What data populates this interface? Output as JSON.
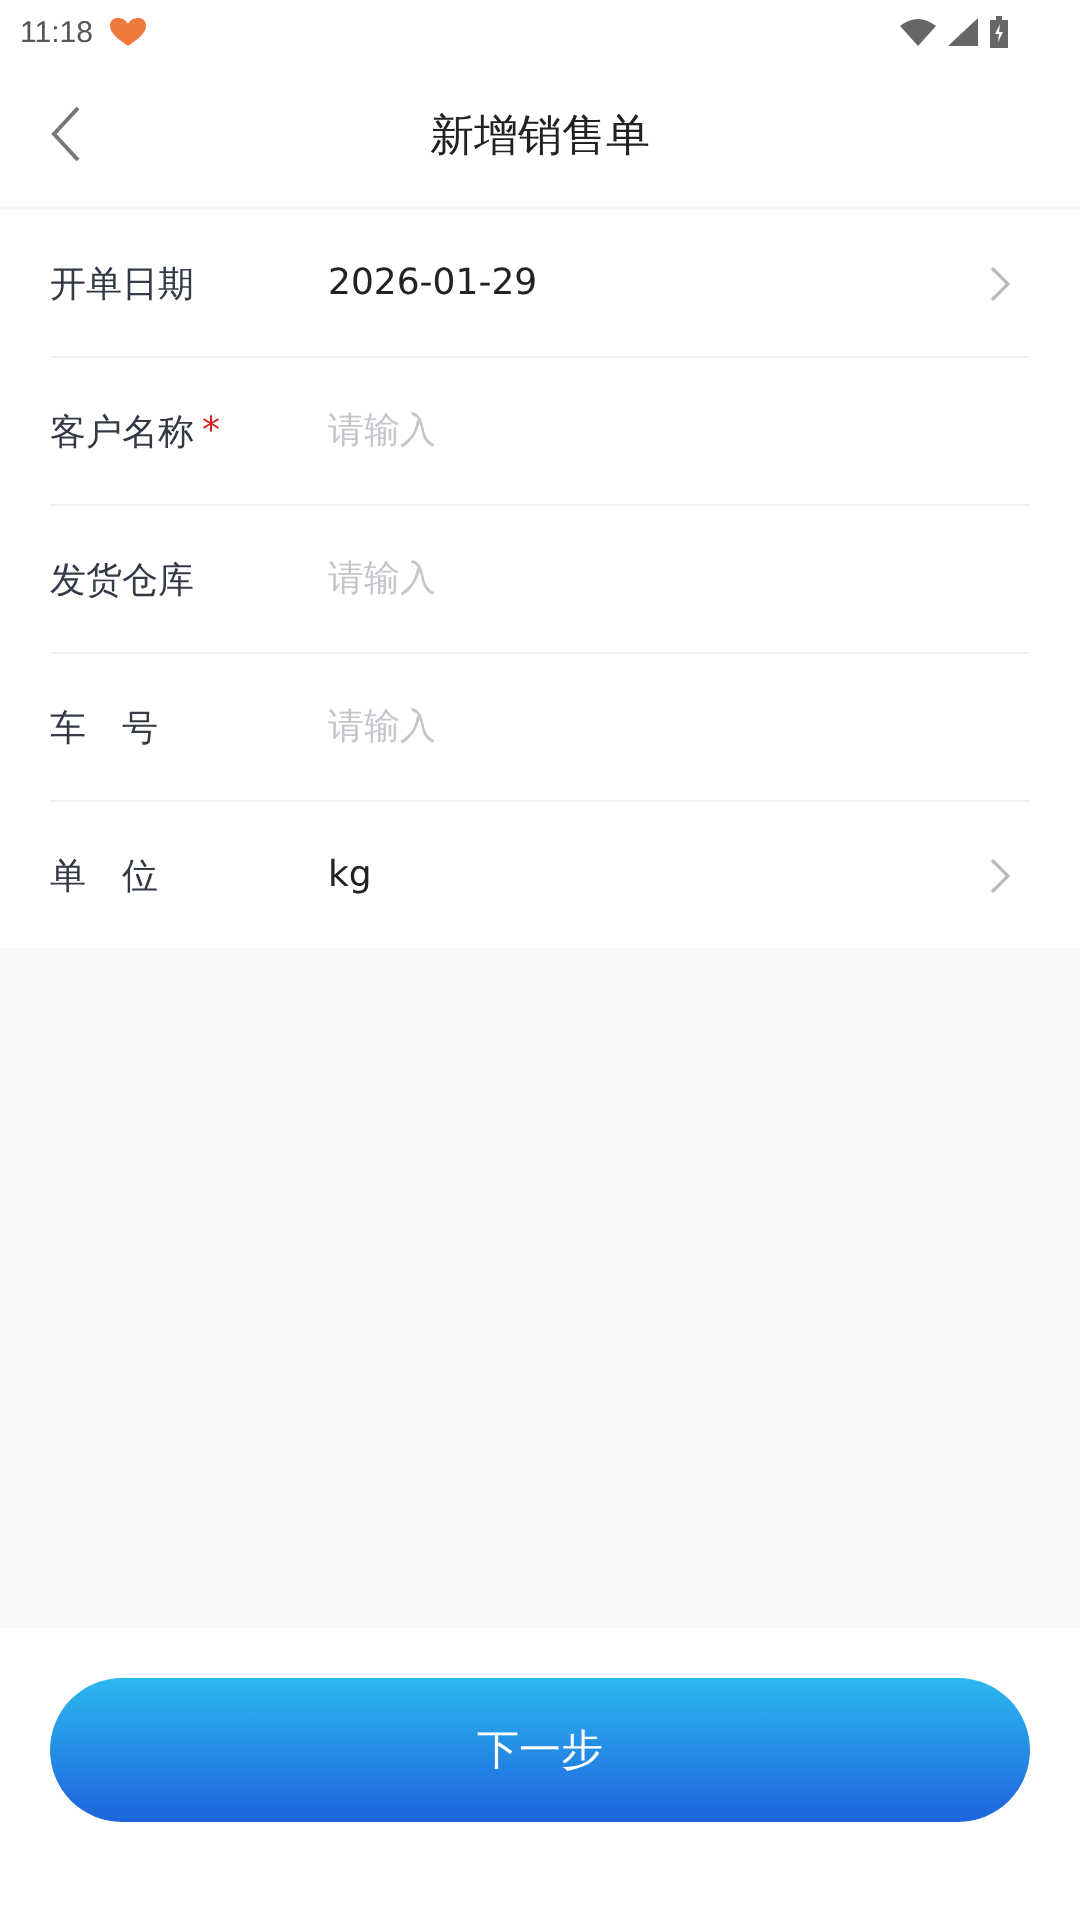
{
  "status_bar": {
    "time": "11:18"
  },
  "header": {
    "title": "新增销售单"
  },
  "fields": [
    {
      "kind": "picker",
      "label": "开单日期",
      "value": "2026-01-29"
    },
    {
      "kind": "input",
      "label": "客户名称",
      "required_mark": "*",
      "placeholder": "请输入"
    },
    {
      "kind": "input",
      "label": "发货仓库",
      "placeholder": "请输入"
    },
    {
      "kind": "input",
      "label": "车　号",
      "placeholder": "请输入"
    },
    {
      "kind": "picker",
      "label": "单　位",
      "value": "kg"
    }
  ],
  "footer": {
    "button": "下一步"
  }
}
